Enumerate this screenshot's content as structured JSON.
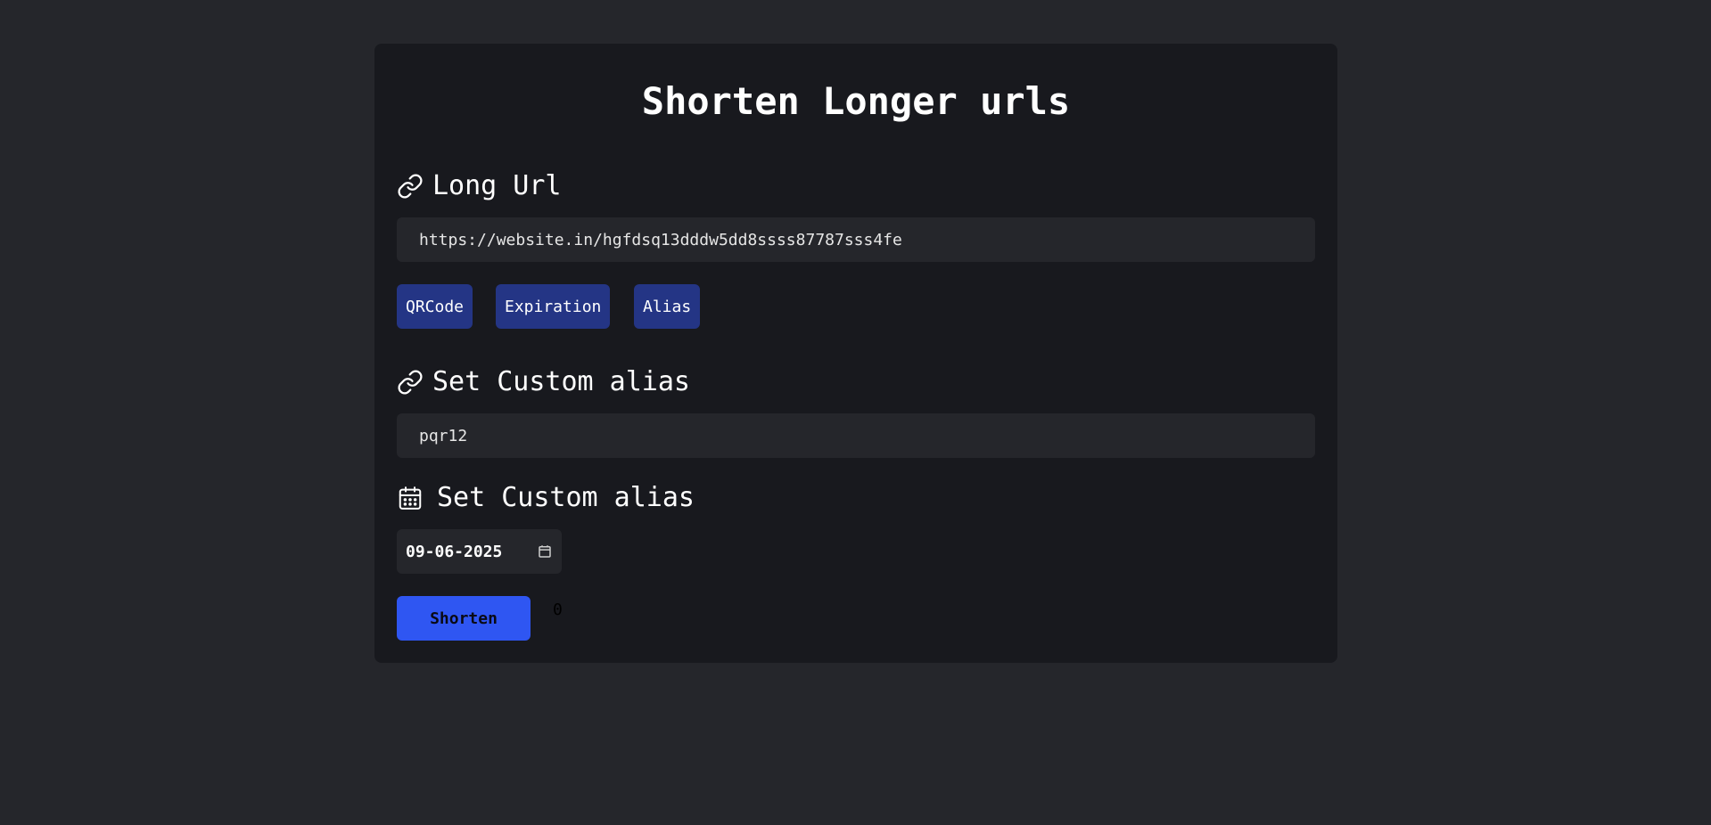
{
  "page": {
    "title": "Shorten Longer urls"
  },
  "long_url": {
    "label": "Long Url",
    "icon": "link-icon",
    "value": "https://website.in/hgfdsq13dddw5dd8ssss87787sss4fe"
  },
  "options": {
    "qrcode_label": "QRCode",
    "expiration_label": "Expiration",
    "alias_label": "Alias"
  },
  "alias": {
    "label": "Set Custom alias",
    "icon": "link-icon",
    "value": "pqr12"
  },
  "expiration": {
    "label": "Set Custom alias",
    "icon": "calendar-icon",
    "date_value": "09-06-2025"
  },
  "actions": {
    "shorten_label": "Shorten",
    "counter": "0"
  },
  "colors": {
    "page_background": "#25262b",
    "card_background": "#18191e",
    "chip_background": "#243585",
    "primary_button": "#2f56f2"
  }
}
